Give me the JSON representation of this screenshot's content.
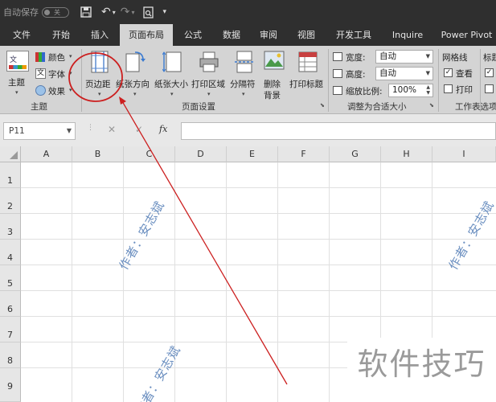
{
  "titlebar": {
    "autosave_label": "自动保存",
    "autosave_state": "关",
    "icons": [
      "save-icon",
      "undo-icon",
      "redo-icon",
      "print-preview-icon",
      "customize-icon"
    ]
  },
  "tabs": [
    {
      "label": "文件"
    },
    {
      "label": "开始"
    },
    {
      "label": "插入"
    },
    {
      "label": "页面布局",
      "active": true
    },
    {
      "label": "公式"
    },
    {
      "label": "数据"
    },
    {
      "label": "审阅"
    },
    {
      "label": "视图"
    },
    {
      "label": "开发工具"
    },
    {
      "label": "Inquire"
    },
    {
      "label": "Power Pivot"
    }
  ],
  "ribbon": {
    "themes": {
      "theme_label": "主题",
      "colors": "颜色",
      "fonts": "字体",
      "effects": "效果",
      "group": "主题"
    },
    "page_setup": {
      "margins": "页边距",
      "orientation": "纸张方向",
      "size": "纸张大小",
      "print_area": "打印区域",
      "breaks": "分隔符",
      "background_1": "删除",
      "background_2": "背景",
      "print_titles": "打印标题",
      "group": "页面设置"
    },
    "scale": {
      "width_label": "宽度:",
      "width_value": "自动",
      "height_label": "高度:",
      "height_value": "自动",
      "scale_label": "缩放比例:",
      "scale_value": "100%",
      "group": "调整为合适大小"
    },
    "sheet_options": {
      "gridlines": "网格线",
      "view": "查看",
      "print": "打印",
      "headings": "标题",
      "group": "工作表选项"
    }
  },
  "formula_bar": {
    "name_box": "P11",
    "fx": "fx",
    "cancel": "✕",
    "enter": "✓"
  },
  "columns": [
    "A",
    "B",
    "C",
    "D",
    "E",
    "F",
    "G",
    "H",
    "I"
  ],
  "rows": [
    "1",
    "2",
    "3",
    "4",
    "5",
    "6",
    "7",
    "8",
    "9"
  ],
  "watermarks": [
    "作者：安志斌",
    "作者：安志斌",
    "作者：安志斌"
  ],
  "brand_watermark": "软件技巧",
  "colors": {
    "annotation_red": "#cc1f1f",
    "watermark_blue": "#6b8fc0",
    "ribbon_bg": "#d4d4d4",
    "titlebar_bg": "#2f2f2f"
  }
}
